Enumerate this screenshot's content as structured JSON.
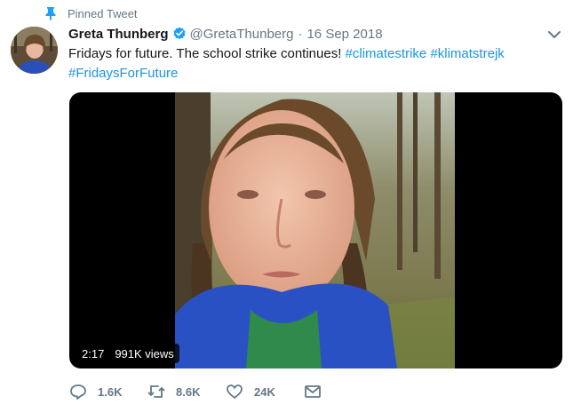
{
  "pinned": {
    "label": "Pinned Tweet",
    "icon": "pin-icon"
  },
  "author": {
    "display_name": "Greta Thunberg",
    "verified_icon": "verified-badge-icon",
    "handle": "@GretaThunberg",
    "separator": "·",
    "date": "16 Sep 2018"
  },
  "tweet": {
    "text": "Fridays for future. The school strike continues!",
    "hashtags": [
      "#climatestrike",
      "#klimatstrejk",
      "#FridaysForFuture"
    ]
  },
  "video": {
    "duration": "2:17",
    "views": "991K views"
  },
  "actions": {
    "replies": "1.6K",
    "retweets": "8.6K",
    "likes": "24K",
    "icons": [
      "reply-icon",
      "retweet-icon",
      "like-icon",
      "direct-message-icon"
    ]
  },
  "colors": {
    "accent": "#1da1f2",
    "hashtag": "#1b95e0",
    "muted": "#657786",
    "text": "#14171a"
  }
}
